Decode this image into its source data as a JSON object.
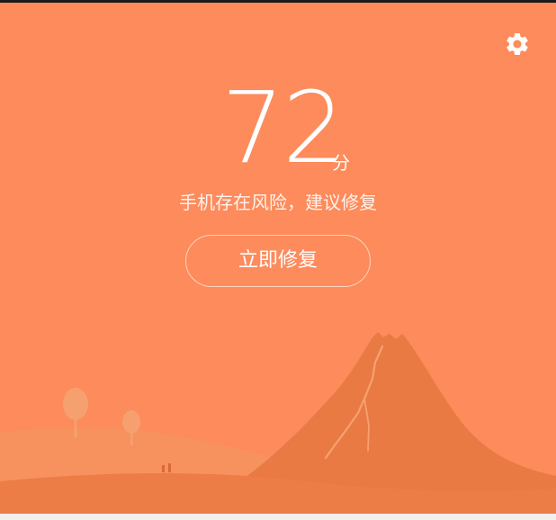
{
  "score": {
    "value": "72",
    "unit": "分"
  },
  "status_text": "手机存在风险，建议修复",
  "actions": {
    "fix_now_label": "立即修复"
  },
  "icons": {
    "settings": "gear-icon"
  },
  "colors": {
    "background": "#fd8b5c",
    "hill_light": "#f7925f",
    "mountain": "#e97a44",
    "ground": "#ec7d47",
    "text": "#ffffff"
  }
}
